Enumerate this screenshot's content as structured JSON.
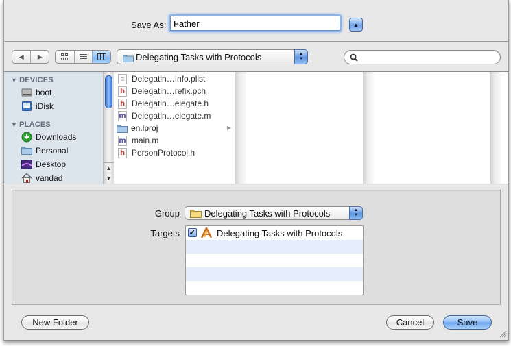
{
  "dialog": {
    "save_as_label": "Save As:",
    "save_as_value": "Father",
    "expand_button_glyph": "▲"
  },
  "toolbar": {
    "back_glyph": "◀",
    "forward_glyph": "▶",
    "view_icon_glyph": "⊞",
    "view_list_glyph": "≡",
    "view_column_glyph": "▥",
    "active_view": "columns",
    "location": "Delegating Tasks with Protocols",
    "search_placeholder": "",
    "search_value": ""
  },
  "sidebar": {
    "sections": [
      {
        "label": "DEVICES",
        "items": [
          {
            "label": "boot",
            "icon": "hard-drive-icon"
          },
          {
            "label": "iDisk",
            "icon": "idisk-icon"
          }
        ]
      },
      {
        "label": "PLACES",
        "items": [
          {
            "label": "Downloads",
            "icon": "downloads-icon"
          },
          {
            "label": "Personal",
            "icon": "folder-icon"
          },
          {
            "label": "Desktop",
            "icon": "desktop-icon"
          },
          {
            "label": "vandad",
            "icon": "home-icon"
          }
        ]
      }
    ]
  },
  "files": [
    {
      "name": "Delegatin…Info.plist",
      "type": "plist",
      "glyph": "≡"
    },
    {
      "name": "Delegatin…refix.pch",
      "type": "h",
      "glyph": "h"
    },
    {
      "name": "Delegatin…elegate.h",
      "type": "h",
      "glyph": "h"
    },
    {
      "name": "Delegatin…elegate.m",
      "type": "m",
      "glyph": "m"
    },
    {
      "name": "en.lproj",
      "type": "folder",
      "glyph": ""
    },
    {
      "name": "main.m",
      "type": "m",
      "glyph": "m"
    },
    {
      "name": "PersonProtocol.h",
      "type": "h",
      "glyph": "h"
    }
  ],
  "accessory": {
    "group_label": "Group",
    "group_value": "Delegating Tasks with Protocols",
    "targets_label": "Targets",
    "targets": [
      {
        "label": "Delegating Tasks with Protocols",
        "checked": true,
        "check_glyph": "✓"
      }
    ]
  },
  "buttons": {
    "new_folder": "New Folder",
    "cancel": "Cancel",
    "save": "Save"
  },
  "colors": {
    "accent": "#6aa3ec",
    "sidebar_bg": "#dce4ec",
    "stripe": "#e7eefb"
  }
}
